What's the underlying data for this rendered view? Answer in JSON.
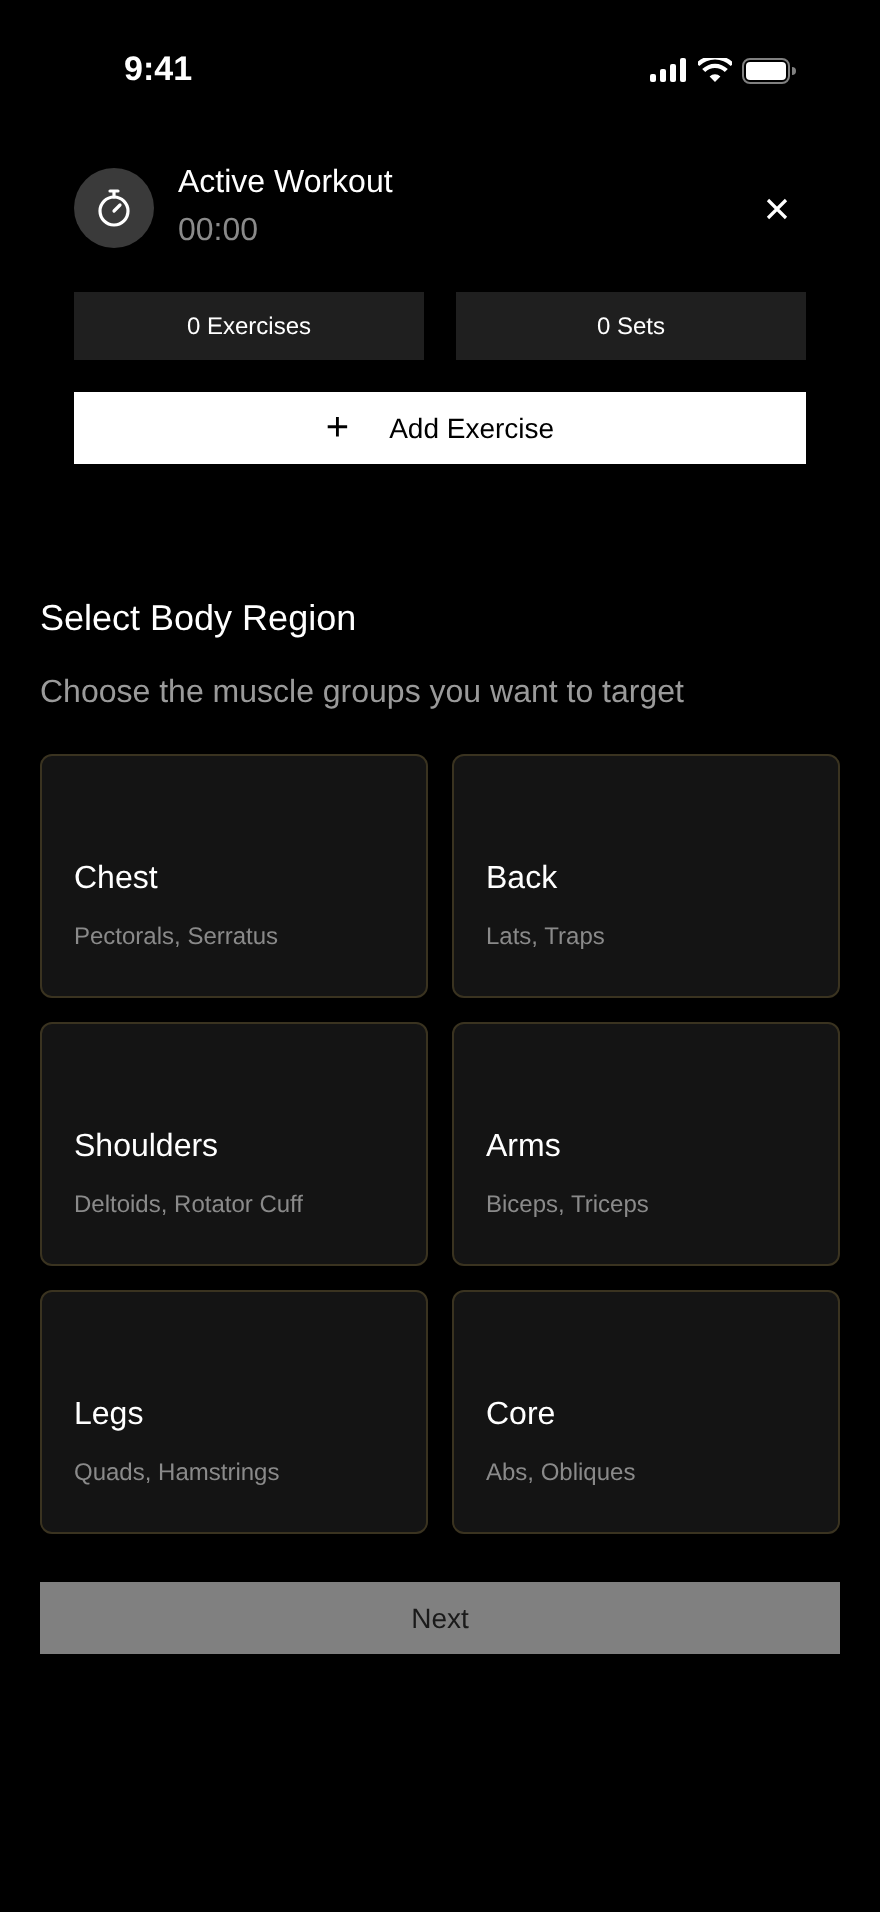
{
  "status_bar": {
    "time": "9:41"
  },
  "workout": {
    "title": "Active Workout",
    "timer": "00:00"
  },
  "stats": [
    "0 Exercises",
    "0 Sets"
  ],
  "add_button": {
    "label": "Add Exercise",
    "icon": "+"
  },
  "section": {
    "title": "Select Body Region",
    "subtitle": "Choose the muscle groups you want to target"
  },
  "regions": [
    {
      "name": "Chest",
      "muscles": "Pectorals, Serratus",
      "selected": false
    },
    {
      "name": "Back",
      "muscles": "Lats, Traps",
      "selected": false
    },
    {
      "name": "Shoulders",
      "muscles": "Deltoids, Rotator Cuff",
      "selected": false
    },
    {
      "name": "Arms",
      "muscles": "Biceps, Triceps",
      "selected": false
    },
    {
      "name": "Legs",
      "muscles": "Quads, Hamstrings",
      "selected": false
    },
    {
      "name": "Core",
      "muscles": "Abs, Obliques",
      "selected": false
    }
  ],
  "next_button": {
    "label": "Next",
    "disabled": true
  }
}
